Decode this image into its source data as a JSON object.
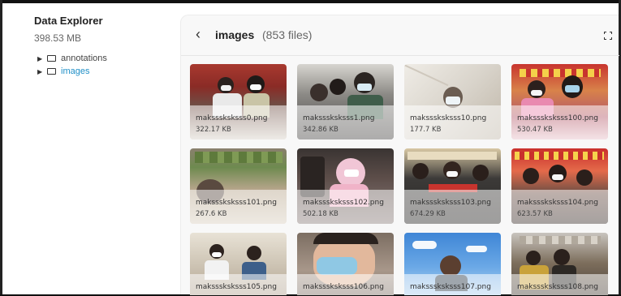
{
  "sidebar": {
    "title": "Data Explorer",
    "size": "398.53 MB",
    "items": [
      {
        "label": "annotations",
        "expanded": false,
        "active": false
      },
      {
        "label": "images",
        "expanded": false,
        "active": true
      }
    ]
  },
  "panel": {
    "back_icon": "chevron-left-icon",
    "title": "images",
    "count": "(853 files)",
    "expand_icon": "expand-icon"
  },
  "files": [
    {
      "name": "maksssksksss0.png",
      "size": "322.17 KB"
    },
    {
      "name": "maksssksksss1.png",
      "size": "342.86 KB"
    },
    {
      "name": "maksssksksss10.png",
      "size": "177.7 KB"
    },
    {
      "name": "maksssksksss100.png",
      "size": "530.47 KB"
    },
    {
      "name": "maksssksksss101.png",
      "size": "267.6 KB"
    },
    {
      "name": "maksssksksss102.png",
      "size": "502.18 KB"
    },
    {
      "name": "maksssksksss103.png",
      "size": "674.29 KB"
    },
    {
      "name": "maksssksksss104.png",
      "size": "623.57 KB"
    },
    {
      "name": "maksssksksss105.png",
      "size": ""
    },
    {
      "name": "maksssksksss106.png",
      "size": ""
    },
    {
      "name": "maksssksksss107.png",
      "size": ""
    },
    {
      "name": "maksssksksss108.png",
      "size": ""
    }
  ],
  "colors": {
    "accent": "#1f8fc7",
    "panel_bg": "#f8f8f8"
  }
}
